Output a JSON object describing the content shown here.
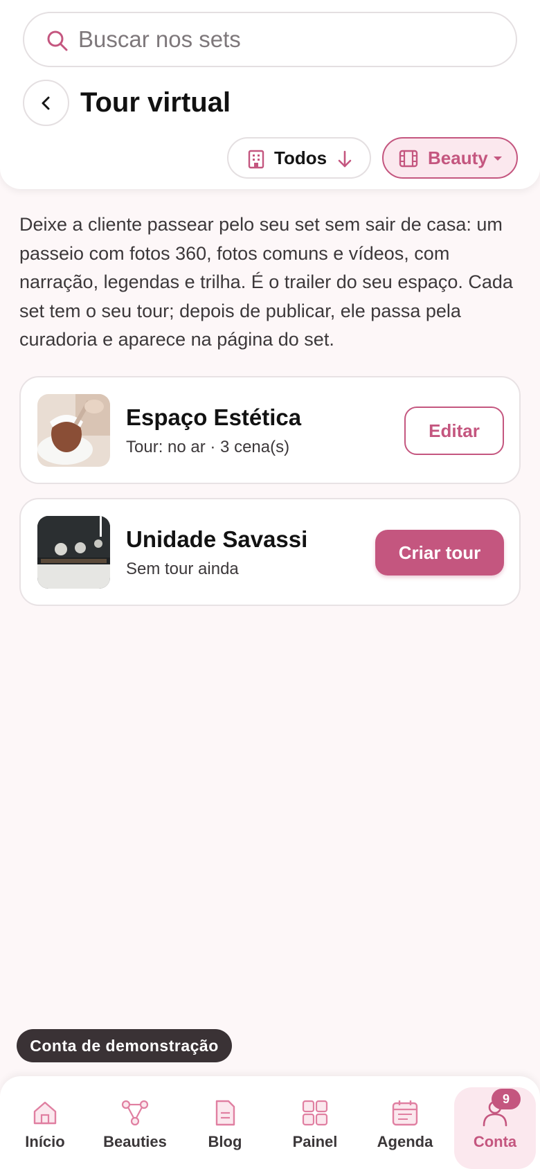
{
  "search": {
    "placeholder": "Buscar nos sets"
  },
  "header": {
    "title": "Tour virtual"
  },
  "filters": {
    "sort_label": "Todos",
    "category_label": "Beauty"
  },
  "description": "Deixe a cliente passear pelo seu set sem sair de casa: um passeio com fotos 360, fotos comuns e vídeos, com narração, legendas e trilha. É o trailer do seu espaço. Cada set tem o seu tour; depois de publicar, ele passa pela curadoria e aparece na página do set.",
  "sets": [
    {
      "name": "Espaço Estética",
      "status": "Tour: no ar · 3 cena(s)",
      "action": "Editar"
    },
    {
      "name": "Unidade Savassi",
      "status": "Sem tour ainda",
      "action": "Criar tour"
    }
  ],
  "demo_label": "Conta de demonstração",
  "nav": {
    "items": [
      {
        "label": "Início",
        "icon": "home-icon"
      },
      {
        "label": "Beauties",
        "icon": "network-icon"
      },
      {
        "label": "Blog",
        "icon": "document-icon"
      },
      {
        "label": "Painel",
        "icon": "grid-icon"
      },
      {
        "label": "Agenda",
        "icon": "calendar-icon"
      },
      {
        "label": "Conta",
        "icon": "user-icon"
      }
    ],
    "active": "Conta",
    "badge": "9"
  },
  "colors": {
    "accent": "#c4567f",
    "accent_light": "#fbe8ee",
    "background": "#fdf7f8"
  }
}
